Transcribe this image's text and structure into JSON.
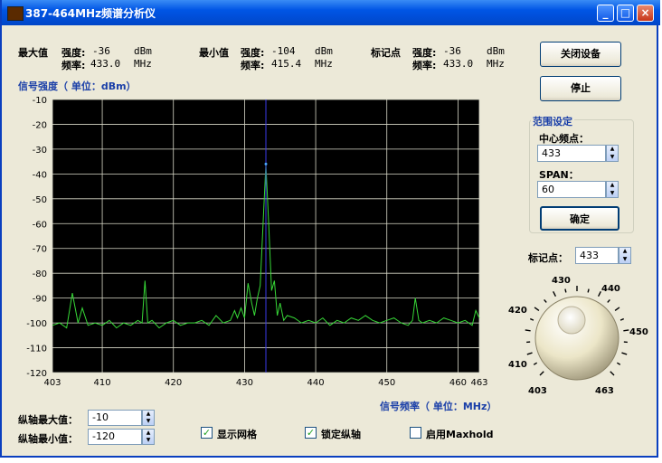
{
  "window": {
    "title": "387-464MHz频谱分析仪",
    "minimize": "_",
    "maximize": "□",
    "close": "×"
  },
  "stats": {
    "max": {
      "label": "最大值",
      "strength_label": "强度:",
      "strength": "-36",
      "strength_unit": "dBm",
      "freq_label": "频率:",
      "freq": "433.0",
      "freq_unit": "MHz"
    },
    "min": {
      "label": "最小值",
      "strength_label": "强度:",
      "strength": "-104",
      "strength_unit": "dBm",
      "freq_label": "频率:",
      "freq": "415.4",
      "freq_unit": "MHz"
    },
    "marker": {
      "label": "标记点",
      "strength_label": "强度:",
      "strength": "-36",
      "strength_unit": "dBm",
      "freq_label": "频率:",
      "freq": "433.0",
      "freq_unit": "MHz"
    }
  },
  "buttons": {
    "close_device": "关闭设备",
    "stop": "停止",
    "confirm": "确定"
  },
  "range": {
    "title": "范围设定",
    "center_label": "中心频点：",
    "center_value": "433",
    "span_label": "SPAN：",
    "span_value": "60"
  },
  "marker_input": {
    "label": "标记点：",
    "value": "433"
  },
  "knob": {
    "labels": [
      "403",
      "410",
      "420",
      "430",
      "440",
      "450",
      "463"
    ]
  },
  "y_axis_controls": {
    "max_label": "纵轴最大值：",
    "max_value": "-10",
    "min_label": "纵轴最小值：",
    "min_value": "-120"
  },
  "checkboxes": [
    {
      "label": "显示网格",
      "checked": true
    },
    {
      "label": "锁定纵轴",
      "checked": true
    },
    {
      "label": "启用Maxhold",
      "checked": false
    }
  ],
  "colors": {
    "plot_bg": "#000000",
    "grid": "#d8d8c8",
    "trace": "#37d837",
    "peak": "#4aa8ff",
    "marker": "#3a3ae8"
  },
  "chart_data": {
    "type": "line",
    "ylabel": "信号强度（ 单位：dBm）",
    "xlabel": "信号频率（ 单位：MHz）",
    "xlim": [
      403,
      463
    ],
    "ylim": [
      -120,
      -10
    ],
    "xticks": [
      403,
      410,
      420,
      430,
      440,
      450,
      460,
      463
    ],
    "yticks": [
      -10,
      -20,
      -30,
      -40,
      -50,
      -60,
      -70,
      -80,
      -90,
      -100,
      -110,
      -120
    ],
    "grid": true,
    "marker_freq": 433,
    "series": [
      {
        "x": [
          403,
          404,
          405,
          405.8,
          406.6,
          407.2,
          408,
          409,
          410,
          411,
          412,
          413,
          414,
          415,
          415.6,
          416,
          416.4,
          417,
          418,
          419,
          420,
          421,
          422,
          423,
          424,
          425,
          426,
          427,
          428,
          428.6,
          429,
          429.5,
          430,
          430.5,
          431,
          431.4,
          431.8,
          432.2,
          432.6,
          433,
          433.4,
          433.8,
          434.2,
          434.6,
          435,
          435.5,
          436,
          437,
          438,
          439,
          440,
          441,
          442,
          443,
          444,
          445,
          446,
          447,
          448,
          449,
          450,
          451,
          452,
          453,
          453.6,
          454,
          454.5,
          455,
          456,
          457,
          458,
          459,
          460,
          461,
          462,
          462.5,
          463
        ],
        "y": [
          -101,
          -100,
          -102,
          -88,
          -100,
          -94,
          -101,
          -100,
          -101,
          -99,
          -102,
          -100,
          -101,
          -99,
          -100,
          -83,
          -100,
          -99,
          -102,
          -100,
          -99,
          -101,
          -100,
          -100,
          -99,
          -101,
          -97,
          -100,
          -99,
          -95,
          -98,
          -94,
          -98,
          -84,
          -92,
          -97,
          -90,
          -85,
          -60,
          -36,
          -60,
          -87,
          -83,
          -97,
          -92,
          -99,
          -97,
          -98,
          -100,
          -99,
          -100,
          -98,
          -101,
          -99,
          -100,
          -98,
          -99,
          -97,
          -99,
          -100,
          -99,
          -98,
          -100,
          -101,
          -99,
          -90,
          -99,
          -100,
          -99,
          -100,
          -98,
          -99,
          -100,
          -99,
          -101,
          -95,
          -98
        ]
      }
    ]
  }
}
